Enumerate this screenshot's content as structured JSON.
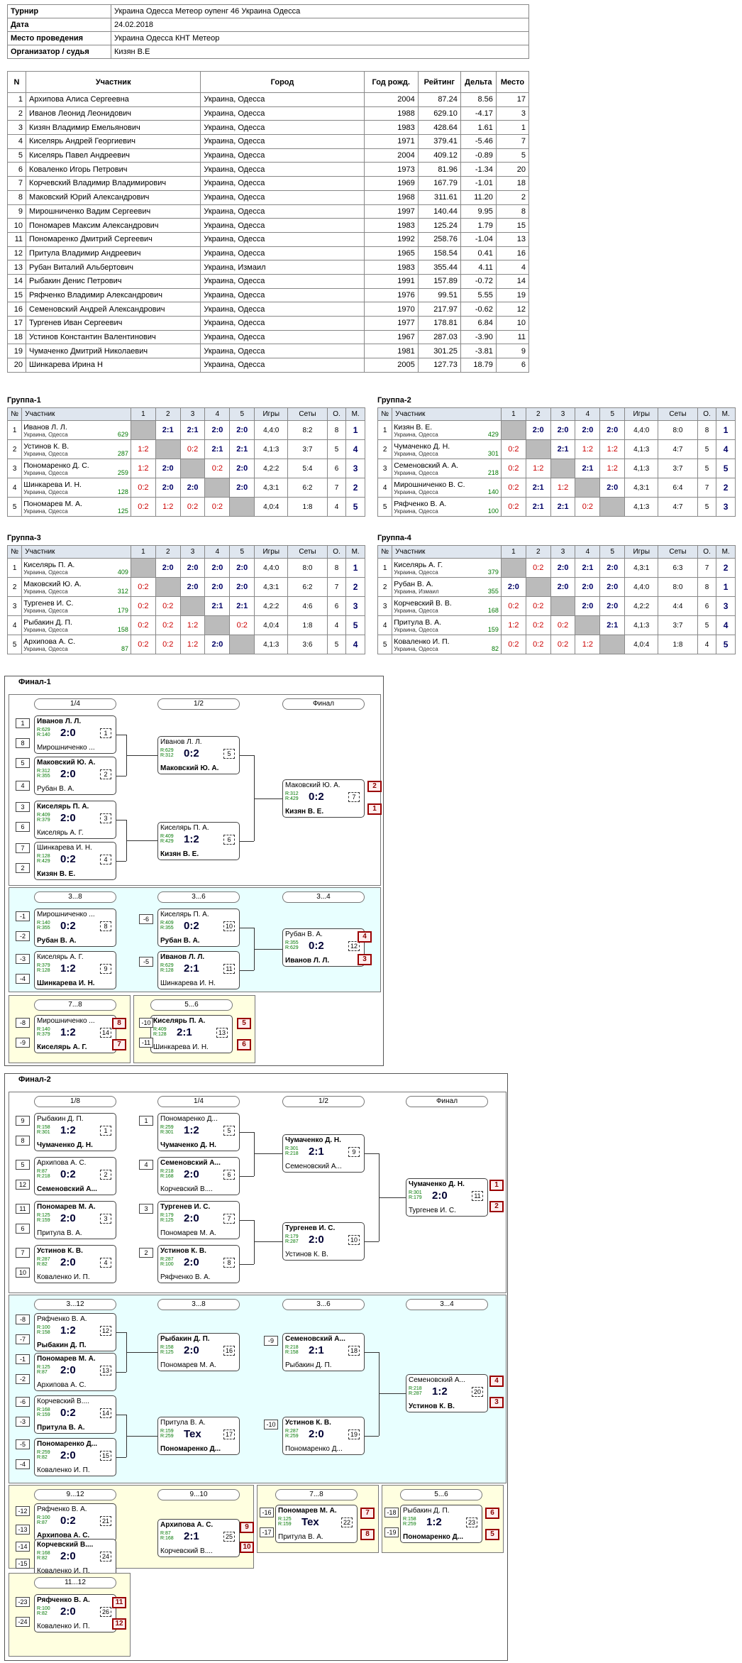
{
  "info": [
    {
      "k": "Турнир",
      "v": "Украина Одесса Метеор оупенг 46 Украина Одесса"
    },
    {
      "k": "Дата",
      "v": "24.02.2018"
    },
    {
      "k": "Место проведения",
      "v": "Украина Одесса КНТ Метеор"
    },
    {
      "k": "Организатор / судья",
      "v": "Кизян В.Е"
    }
  ],
  "players": {
    "headers": [
      "N",
      "Участник",
      "Город",
      "Год рожд.",
      "Рейтинг",
      "Дельта",
      "Место"
    ],
    "rows": [
      [
        "1",
        "Архипова Алиса Сергеевна",
        "Украина, Одесса",
        "2004",
        "87.24",
        "8.56",
        "17"
      ],
      [
        "2",
        "Иванов Леонид Леонидович",
        "Украина, Одесса",
        "1988",
        "629.10",
        "-4.17",
        "3"
      ],
      [
        "3",
        "Кизян Владимир Емельянович",
        "Украина, Одесса",
        "1983",
        "428.64",
        "1.61",
        "1"
      ],
      [
        "4",
        "Киселярь Андрей Георгиевич",
        "Украина, Одесса",
        "1971",
        "379.41",
        "-5.46",
        "7"
      ],
      [
        "5",
        "Киселярь Павел Андреевич",
        "Украина, Одесса",
        "2004",
        "409.12",
        "-0.89",
        "5"
      ],
      [
        "6",
        "Коваленко Игорь Петрович",
        "Украина, Одесса",
        "1973",
        "81.96",
        "-1.34",
        "20"
      ],
      [
        "7",
        "Корчевский Владимир Владимирович",
        "Украина, Одесса",
        "1969",
        "167.79",
        "-1.01",
        "18"
      ],
      [
        "8",
        "Маковский Юрий Александрович",
        "Украина, Одесса",
        "1968",
        "311.61",
        "11.20",
        "2"
      ],
      [
        "9",
        "Мирошниченко Вадим Сергеевич",
        "Украина, Одесса",
        "1997",
        "140.44",
        "9.95",
        "8"
      ],
      [
        "10",
        "Пономарев Максим Александрович",
        "Украина, Одесса",
        "1983",
        "125.24",
        "1.79",
        "15"
      ],
      [
        "11",
        "Пономаренко Дмитрий Сергеевич",
        "Украина, Одесса",
        "1992",
        "258.76",
        "-1.04",
        "13"
      ],
      [
        "12",
        "Притула Владимир Андреевич",
        "Украина, Одесса",
        "1965",
        "158.54",
        "0.41",
        "16"
      ],
      [
        "13",
        "Рубан Виталий Альбертович",
        "Украина, Измаил",
        "1983",
        "355.44",
        "4.11",
        "4"
      ],
      [
        "14",
        "Рыбакин Денис Петрович",
        "Украина, Одесса",
        "1991",
        "157.89",
        "-0.72",
        "14"
      ],
      [
        "15",
        "Ряфченко Владимир Александрович",
        "Украина, Одесса",
        "1976",
        "99.51",
        "5.55",
        "19"
      ],
      [
        "16",
        "Семеновский Андрей Александрович",
        "Украина, Одесса",
        "1970",
        "217.97",
        "-0.62",
        "12"
      ],
      [
        "17",
        "Тургенев Иван Сергеевич",
        "Украина, Одесса",
        "1977",
        "178.81",
        "6.84",
        "10"
      ],
      [
        "18",
        "Устинов Константин Валентинович",
        "Украина, Одесса",
        "1967",
        "287.03",
        "-3.90",
        "11"
      ],
      [
        "19",
        "Чумаченко Дмитрий Николаевич",
        "Украина, Одесса",
        "1981",
        "301.25",
        "-3.81",
        "9"
      ],
      [
        "20",
        "Шинкарева Ирина Н",
        "Украина, Одесса",
        "2005",
        "127.73",
        "18.79",
        "6"
      ]
    ]
  },
  "group_headers": [
    "№",
    "Участник",
    "1",
    "2",
    "3",
    "4",
    "5",
    "Игры",
    "Сеты",
    "О.",
    "М."
  ],
  "groups": [
    {
      "title": "Группа-1",
      "rows": [
        {
          "n": "1",
          "name": "Иванов Л. Л.",
          "city": "Украина, Одесса",
          "r": "629",
          "cells": [
            "",
            "2:1",
            "2:1",
            "2:0",
            "2:0"
          ],
          "games": "4,4:0",
          "sets": "8:2",
          "pts": "8",
          "pl": "1"
        },
        {
          "n": "2",
          "name": "Устинов К. В.",
          "city": "Украина, Одесса",
          "r": "287",
          "cells": [
            "1:2",
            "",
            "0:2",
            "2:1",
            "2:1"
          ],
          "games": "4,1:3",
          "sets": "3:7",
          "pts": "5",
          "pl": "4"
        },
        {
          "n": "3",
          "name": "Пономаренко Д. С.",
          "city": "Украина, Одесса",
          "r": "259",
          "cells": [
            "1:2",
            "2:0",
            "",
            "0:2",
            "2:0"
          ],
          "games": "4,2:2",
          "sets": "5:4",
          "pts": "6",
          "pl": "3"
        },
        {
          "n": "4",
          "name": "Шинкарева И. Н.",
          "city": "Украина, Одесса",
          "r": "128",
          "cells": [
            "0:2",
            "2:0",
            "2:0",
            "",
            "2:0"
          ],
          "games": "4,3:1",
          "sets": "6:2",
          "pts": "7",
          "pl": "2"
        },
        {
          "n": "5",
          "name": "Пономарев М. А.",
          "city": "Украина, Одесса",
          "r": "125",
          "cells": [
            "0:2",
            "1:2",
            "0:2",
            "0:2",
            ""
          ],
          "games": "4,0:4",
          "sets": "1:8",
          "pts": "4",
          "pl": "5"
        }
      ]
    },
    {
      "title": "Группа-2",
      "rows": [
        {
          "n": "1",
          "name": "Кизян В. Е.",
          "city": "Украина, Одесса",
          "r": "429",
          "cells": [
            "",
            "2:0",
            "2:0",
            "2:0",
            "2:0"
          ],
          "games": "4,4:0",
          "sets": "8:0",
          "pts": "8",
          "pl": "1"
        },
        {
          "n": "2",
          "name": "Чумаченко Д. Н.",
          "city": "Украина, Одесса",
          "r": "301",
          "cells": [
            "0:2",
            "",
            "2:1",
            "1:2",
            "1:2"
          ],
          "games": "4,1:3",
          "sets": "4:7",
          "pts": "5",
          "pl": "4"
        },
        {
          "n": "3",
          "name": "Семеновский А. А.",
          "city": "Украина, Одесса",
          "r": "218",
          "cells": [
            "0:2",
            "1:2",
            "",
            "2:1",
            "1:2"
          ],
          "games": "4,1:3",
          "sets": "3:7",
          "pts": "5",
          "pl": "5"
        },
        {
          "n": "4",
          "name": "Мирошниченко В. С.",
          "city": "Украина, Одесса",
          "r": "140",
          "cells": [
            "0:2",
            "2:1",
            "1:2",
            "",
            "2:0"
          ],
          "games": "4,3:1",
          "sets": "6:4",
          "pts": "7",
          "pl": "2"
        },
        {
          "n": "5",
          "name": "Ряфченко В. А.",
          "city": "Украина, Одесса",
          "r": "100",
          "cells": [
            "0:2",
            "2:1",
            "2:1",
            "0:2",
            ""
          ],
          "games": "4,1:3",
          "sets": "4:7",
          "pts": "5",
          "pl": "3"
        }
      ]
    },
    {
      "title": "Группа-3",
      "rows": [
        {
          "n": "1",
          "name": "Киселярь П. А.",
          "city": "Украина, Одесса",
          "r": "409",
          "cells": [
            "",
            "2:0",
            "2:0",
            "2:0",
            "2:0"
          ],
          "games": "4,4:0",
          "sets": "8:0",
          "pts": "8",
          "pl": "1"
        },
        {
          "n": "2",
          "name": "Маковский Ю. А.",
          "city": "Украина, Одесса",
          "r": "312",
          "cells": [
            "0:2",
            "",
            "2:0",
            "2:0",
            "2:0"
          ],
          "games": "4,3:1",
          "sets": "6:2",
          "pts": "7",
          "pl": "2"
        },
        {
          "n": "3",
          "name": "Тургенев И. С.",
          "city": "Украина, Одесса",
          "r": "179",
          "cells": [
            "0:2",
            "0:2",
            "",
            "2:1",
            "2:1"
          ],
          "games": "4,2:2",
          "sets": "4:6",
          "pts": "6",
          "pl": "3"
        },
        {
          "n": "4",
          "name": "Рыбакин Д. П.",
          "city": "Украина, Одесса",
          "r": "158",
          "cells": [
            "0:2",
            "0:2",
            "1:2",
            "",
            "0:2"
          ],
          "games": "4,0:4",
          "sets": "1:8",
          "pts": "4",
          "pl": "5"
        },
        {
          "n": "5",
          "name": "Архипова А. С.",
          "city": "Украина, Одесса",
          "r": "87",
          "cells": [
            "0:2",
            "0:2",
            "1:2",
            "2:0",
            ""
          ],
          "games": "4,1:3",
          "sets": "3:6",
          "pts": "5",
          "pl": "4"
        }
      ]
    },
    {
      "title": "Группа-4",
      "rows": [
        {
          "n": "1",
          "name": "Киселярь А. Г.",
          "city": "Украина, Одесса",
          "r": "379",
          "cells": [
            "",
            "0:2",
            "2:0",
            "2:1",
            "2:0"
          ],
          "games": "4,3:1",
          "sets": "6:3",
          "pts": "7",
          "pl": "2"
        },
        {
          "n": "2",
          "name": "Рубан В. А.",
          "city": "Украина, Измаил",
          "r": "355",
          "cells": [
            "2:0",
            "",
            "2:0",
            "2:0",
            "2:0"
          ],
          "games": "4,4:0",
          "sets": "8:0",
          "pts": "8",
          "pl": "1"
        },
        {
          "n": "3",
          "name": "Корчевский В. В.",
          "city": "Украина, Одесса",
          "r": "168",
          "cells": [
            "0:2",
            "0:2",
            "",
            "2:0",
            "2:0"
          ],
          "games": "4,2:2",
          "sets": "4:4",
          "pts": "6",
          "pl": "3"
        },
        {
          "n": "4",
          "name": "Притула В. А.",
          "city": "Украина, Одесса",
          "r": "159",
          "cells": [
            "1:2",
            "0:2",
            "0:2",
            "",
            "2:1"
          ],
          "games": "4,1:3",
          "sets": "3:7",
          "pts": "5",
          "pl": "4"
        },
        {
          "n": "5",
          "name": "Коваленко И. П.",
          "city": "Украина, Одесса",
          "r": "82",
          "cells": [
            "0:2",
            "0:2",
            "0:2",
            "1:2",
            ""
          ],
          "games": "4,0:4",
          "sets": "1:8",
          "pts": "4",
          "pl": "5"
        }
      ]
    }
  ],
  "final1": {
    "title": "Финал-1",
    "rounds": [
      "1/4",
      "1/2",
      "Финал"
    ],
    "cons": [
      "3...8",
      "3...6",
      "3...4"
    ],
    "r78": "7...8",
    "r56": "5...6"
  },
  "final2": {
    "title": "Финал-2",
    "rounds": [
      "1/8",
      "1/4",
      "1/2",
      "Финал"
    ],
    "cons": [
      "3...12",
      "3...8",
      "3...6",
      "3...4"
    ],
    "r912": [
      "9...12",
      "9...10"
    ],
    "r78": "7...8",
    "r56": "5...6",
    "r1112": "11...12"
  },
  "matches": [
    {
      "id": "f1_qf1",
      "p1": "Иванов Л. Л.",
      "p2": "Мирошниченко ...",
      "r1": "R:629",
      "r2": "R:140",
      "sc": "2:0",
      "n": "1",
      "w": 1
    },
    {
      "id": "f1_qf2",
      "p1": "Маковский Ю. А.",
      "p2": "Рубан В. А.",
      "r1": "R:312",
      "r2": "R:355",
      "sc": "2:0",
      "n": "2",
      "w": 1
    },
    {
      "id": "f1_qf3",
      "p1": "Киселярь П. А.",
      "p2": "Киселярь А. Г.",
      "r1": "R:409",
      "r2": "R:379",
      "sc": "2:0",
      "n": "3",
      "w": 1
    },
    {
      "id": "f1_qf4",
      "p1": "Шинкарева И. Н.",
      "p2": "Кизян В. Е.",
      "r1": "R:128",
      "r2": "R:429",
      "sc": "0:2",
      "n": "4",
      "w": 2
    },
    {
      "id": "f1_sf1",
      "p1": "Иванов Л. Л.",
      "p2": "Маковский Ю. А.",
      "r1": "R:629",
      "r2": "R:312",
      "sc": "0:2",
      "n": "5",
      "w": 2
    },
    {
      "id": "f1_sf2",
      "p1": "Киселярь П. А.",
      "p2": "Кизян В. Е.",
      "r1": "R:409",
      "r2": "R:429",
      "sc": "1:2",
      "n": "6",
      "w": 2
    },
    {
      "id": "f1_f",
      "p1": "Маковский Ю. А.",
      "p2": "Кизян В. Е.",
      "r1": "R:312",
      "r2": "R:429",
      "sc": "0:2",
      "n": "7",
      "w": 2
    },
    {
      "id": "f1_c1",
      "p1": "Мирошниченко ...",
      "p2": "Рубан В. А.",
      "r1": "R:140",
      "r2": "R:355",
      "sc": "0:2",
      "n": "8",
      "w": 2
    },
    {
      "id": "f1_c2",
      "p1": "Киселярь А. Г.",
      "p2": "Шинкарева И. Н.",
      "r1": "R:379",
      "r2": "R:128",
      "sc": "1:2",
      "n": "9",
      "w": 2
    },
    {
      "id": "f1_c3",
      "p1": "Киселярь П. А.",
      "p2": "Рубан В. А.",
      "r1": "R:409",
      "r2": "R:355",
      "sc": "0:2",
      "n": "10",
      "w": 2
    },
    {
      "id": "f1_c4",
      "p1": "Иванов Л. Л.",
      "p2": "Шинкарева И. Н.",
      "r1": "R:629",
      "r2": "R:128",
      "sc": "2:1",
      "n": "11",
      "w": 1
    },
    {
      "id": "f1_c5",
      "p1": "Рубан В. А.",
      "p2": "Иванов Л. Л.",
      "r1": "R:355",
      "r2": "R:629",
      "sc": "0:2",
      "n": "12",
      "w": 2
    },
    {
      "id": "f1_c78",
      "p1": "Мирошниченко ...",
      "p2": "Киселярь А. Г.",
      "r1": "R:140",
      "r2": "R:379",
      "sc": "1:2",
      "n": "14",
      "w": 2
    },
    {
      "id": "f1_c56",
      "p1": "Киселярь П. А.",
      "p2": "Шинкарева И. Н.",
      "r1": "R:409",
      "r2": "R:128",
      "sc": "2:1",
      "n": "13",
      "w": 1
    },
    {
      "id": "f2_r1",
      "p1": "Рыбакин Д. П.",
      "p2": "Чумаченко Д. Н.",
      "r1": "R:158",
      "r2": "R:301",
      "sc": "1:2",
      "n": "1",
      "w": 2
    },
    {
      "id": "f2_r2",
      "p1": "Архипова А. С.",
      "p2": "Семеновский А...",
      "r1": "R:87",
      "r2": "R:218",
      "sc": "0:2",
      "n": "2",
      "w": 2
    },
    {
      "id": "f2_r3",
      "p1": "Пономарев М. А.",
      "p2": "Притула В. А.",
      "r1": "R:125",
      "r2": "R:159",
      "sc": "2:0",
      "n": "3",
      "w": 1
    },
    {
      "id": "f2_r4",
      "p1": "Устинов К. В.",
      "p2": "Коваленко И. П.",
      "r1": "R:287",
      "r2": "R:82",
      "sc": "2:0",
      "n": "4",
      "w": 1
    },
    {
      "id": "f2_q1",
      "p1": "Пономаренко Д...",
      "p2": "Чумаченко Д. Н.",
      "r1": "R:259",
      "r2": "R:301",
      "sc": "1:2",
      "n": "5",
      "w": 2
    },
    {
      "id": "f2_q2",
      "p1": "Семеновский А...",
      "p2": "Корчевский В....",
      "r1": "R:218",
      "r2": "R:168",
      "sc": "2:0",
      "n": "6",
      "w": 1
    },
    {
      "id": "f2_q3",
      "p1": "Тургенев И. С.",
      "p2": "Пономарев М. А.",
      "r1": "R:179",
      "r2": "R:125",
      "sc": "2:0",
      "n": "7",
      "w": 1
    },
    {
      "id": "f2_q4",
      "p1": "Устинов К. В.",
      "p2": "Ряфченко В. А.",
      "r1": "R:287",
      "r2": "R:100",
      "sc": "2:0",
      "n": "8",
      "w": 1
    },
    {
      "id": "f2_s1",
      "p1": "Чумаченко Д. Н.",
      "p2": "Семеновский А...",
      "r1": "R:301",
      "r2": "R:218",
      "sc": "2:1",
      "n": "9",
      "w": 1
    },
    {
      "id": "f2_s2",
      "p1": "Тургенев И. С.",
      "p2": "Устинов К. В.",
      "r1": "R:179",
      "r2": "R:287",
      "sc": "2:0",
      "n": "10",
      "w": 1
    },
    {
      "id": "f2_f",
      "p1": "Чумаченко Д. Н.",
      "p2": "Тургенев И. С.",
      "r1": "R:301",
      "r2": "R:179",
      "sc": "2:0",
      "n": "11",
      "w": 1
    },
    {
      "id": "f2_c1",
      "p1": "Ряфченко В. А.",
      "p2": "Рыбакин Д. П.",
      "r1": "R:100",
      "r2": "R:158",
      "sc": "1:2",
      "n": "12",
      "w": 2
    },
    {
      "id": "f2_c2",
      "p1": "Пономарев М. А.",
      "p2": "Архипова А. С.",
      "r1": "R:125",
      "r2": "R:87",
      "sc": "2:0",
      "n": "13",
      "w": 1
    },
    {
      "id": "f2_c3",
      "p1": "Корчевский В....",
      "p2": "Притула В. А.",
      "r1": "R:168",
      "r2": "R:159",
      "sc": "0:2",
      "n": "14",
      "w": 2
    },
    {
      "id": "f2_c4",
      "p1": "Пономаренко Д...",
      "p2": "Коваленко И. П.",
      "r1": "R:259",
      "r2": "R:82",
      "sc": "2:0",
      "n": "15",
      "w": 1
    },
    {
      "id": "f2_c5",
      "p1": "Рыбакин Д. П.",
      "p2": "Пономарев М. А.",
      "r1": "R:158",
      "r2": "R:125",
      "sc": "2:0",
      "n": "16",
      "w": 1
    },
    {
      "id": "f2_c6",
      "p1": "Притула В. А.",
      "p2": "Пономаренко Д...",
      "r1": "R:159",
      "r2": "R:259",
      "sc": "Tex",
      "n": "17",
      "w": 2
    },
    {
      "id": "f2_c7",
      "p1": "Семеновский А...",
      "p2": "Рыбакин Д. П.",
      "r1": "R:218",
      "r2": "R:158",
      "sc": "2:1",
      "n": "18",
      "w": 1
    },
    {
      "id": "f2_c8",
      "p1": "Устинов К. В.",
      "p2": "Пономаренко Д...",
      "r1": "R:287",
      "r2": "R:259",
      "sc": "2:0",
      "n": "19",
      "w": 1
    },
    {
      "id": "f2_c9",
      "p1": "Семеновский А...",
      "p2": "Устинов К. В.",
      "r1": "R:218",
      "r2": "R:287",
      "sc": "1:2",
      "n": "20",
      "w": 2
    },
    {
      "id": "f2_d1",
      "p1": "Ряфченко В. А.",
      "p2": "Архипова А. С.",
      "r1": "R:100",
      "r2": "R:87",
      "sc": "0:2",
      "n": "21",
      "w": 2
    },
    {
      "id": "f2_d2",
      "p1": "Корчевский В....",
      "p2": "Коваленко И. П.",
      "r1": "R:168",
      "r2": "R:82",
      "sc": "2:0",
      "n": "24",
      "w": 1
    },
    {
      "id": "f2_d3",
      "p1": "Архипова А. С.",
      "p2": "Корчевский В....",
      "r1": "R:87",
      "r2": "R:168",
      "sc": "2:1",
      "n": "25",
      "w": 1
    },
    {
      "id": "f2_d4",
      "p1": "Пономарев М. А.",
      "p2": "Притула В. А.",
      "r1": "R:125",
      "r2": "R:159",
      "sc": "Tex",
      "n": "22",
      "w": 1
    },
    {
      "id": "f2_d5",
      "p1": "Рыбакин Д. П.",
      "p2": "Пономаренко Д...",
      "r1": "R:158",
      "r2": "R:259",
      "sc": "1:2",
      "n": "23",
      "w": 2
    },
    {
      "id": "f2_d6",
      "p1": "Ряфченко В. А.",
      "p2": "Коваленко И. П.",
      "r1": "R:100",
      "r2": "R:82",
      "sc": "2:0",
      "n": "26",
      "w": 1
    }
  ]
}
